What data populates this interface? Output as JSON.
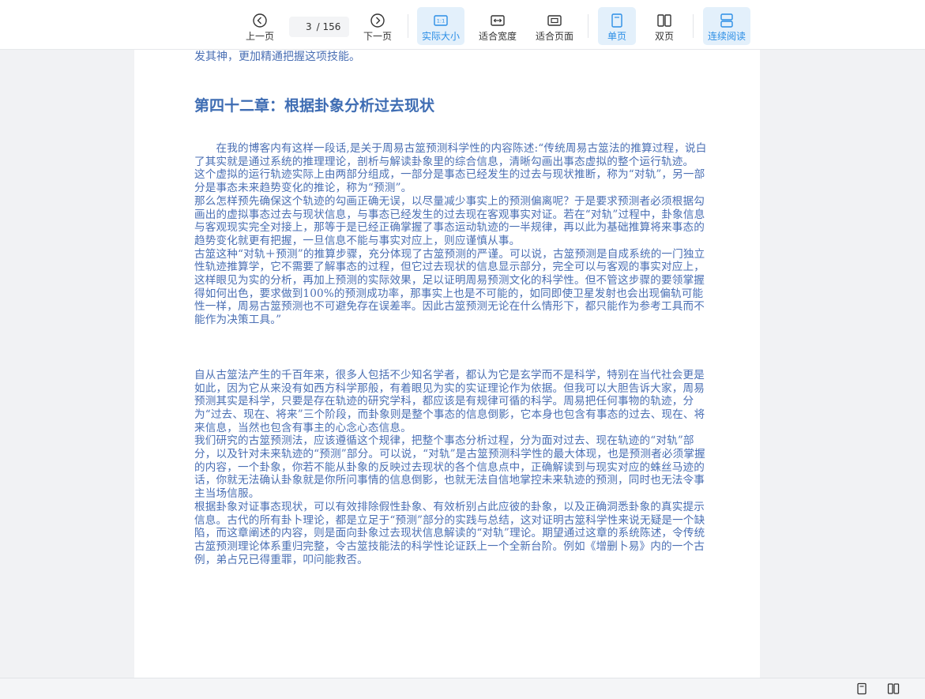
{
  "toolbar": {
    "prev_label": "上一页",
    "current_page": "3",
    "total_pages": "/ 156",
    "next_label": "下一页",
    "actual_size_label": "实际大小",
    "fit_width_label": "适合宽度",
    "fit_page_label": "适合页面",
    "single_page_label": "单页",
    "double_page_label": "双页",
    "continuous_label": "连续阅读",
    "active_color": "#2b8ee6"
  },
  "document": {
    "prev_tail": "发其神，更加精通把握这项技能。",
    "chapter_title": "第四十二章：根据卦象分析过去现状",
    "paragraphs_a": [
      "　　在我的博客内有这样一段话,是关于周易古筮预测科学性的内容陈述:“传统周易古筮法的推算过程，说白了其实就是通过系统的推理理论，剖析与解读卦象里的综合信息，清晰勾画出事态虚拟的整个运行轨迹。",
      "这个虚拟的运行轨迹实际上由两部分组成，一部分是事态已经发生的过去与现状推断，称为“对轨”，另一部分是事态未来趋势变化的推论，称为“预测”。",
      "那么怎样预先确保这个轨迹的勾画正确无误，以尽量减少事实上的预测偏离呢？于是要求预测者必须根据勾画出的虚拟事态过去与现状信息，与事态已经发生的过去现在客观事实对证。若在“对轨”过程中，卦象信息与客观现实完全对接上，那等于是已经正确掌握了事态运动轨迹的一半规律，再以此为基础推算将来事态的趋势变化就更有把握，一旦信息不能与事实对应上，则应谨慎从事。",
      "古筮这种“对轨＋预测”的推算步骤，充分体现了古筮预测的严谨。可以说，古筮预测是自成系统的一门独立性轨迹推算学，它不需要了解事态的过程，但它过去现状的信息显示部分，完全可以与客观的事实对应上，这样眼见为实的分析，再加上预测的实际效果，足以证明周易预测文化的科学性。但不管这步骤的要领掌握得如何出色，要求做到100%的预测成功率，那事实上也是不可能的，如同即使卫星发射也会出现偏轨可能性一样，周易古筮预测也不可避免存在误差率。因此古筮预测无论在什么情形下，都只能作为参考工具而不能作为决策工具。”"
    ],
    "paragraphs_b": [
      "自从古筮法产生的千百年来，很多人包括不少知名学者，都认为它是玄学而不是科学，特别在当代社会更是如此，因为它从来没有如西方科学那般，有着眼见为实的实证理论作为依据。但我可以大胆告诉大家，周易预测其实是科学，只要是存在轨迹的研究学科，都应该是有规律可循的科学。周易把任何事物的轨迹，分为“过去、现在、将来”三个阶段，而卦象则是整个事态的信息倒影，它本身也包含有事态的过去、现在、将来信息，当然也包含有事主的心念心态信息。",
      "我们研究的古筮预测法，应该遵循这个规律，把整个事态分析过程，分为面对过去、现在轨迹的“对轨”部分，以及针对未来轨迹的“预测”部分。可以说，“对轨”是古筮预测科学性的最大体现，也是预测者必须掌握的内容，一个卦象，你若不能从卦象的反映过去现状的各个信息点中，正确解读到与现实对应的蛛丝马迹的话，你就无法确认卦象就是你所问事情的信息倒影，也就无法自信地掌控未来轨迹的预测，同时也无法令事主当场信服。",
      "根据卦象对证事态现状，可以有效排除假性卦象、有效析别占此应彼的卦象，以及正确洞悉卦象的真实提示信息。古代的所有卦卜理论，都是立足于“预测”部分的实践与总结，这对证明古筮科学性来说无疑是一个缺陷，而这章阐述的内容，则是面向卦象过去现状信息解读的“对轨”理论。期望通过这章的系统陈述，令传统古筮预测理论体系重归完整，令古筮技能法的科学性论证跃上一个全新台阶。例如《增删卜易》内的一个古例，弟占兄已得重罪，叩问能救否。"
    ]
  }
}
